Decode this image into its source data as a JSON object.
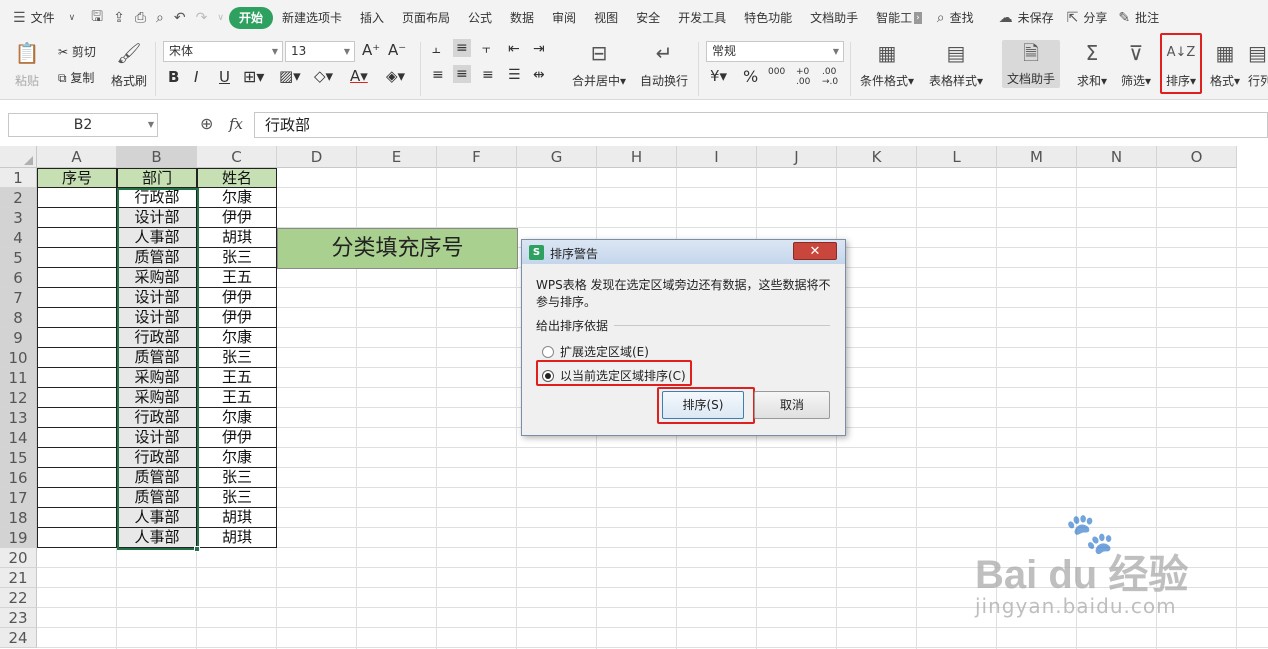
{
  "menubar": {
    "file": "文件",
    "tabs": [
      "开始",
      "新建选项卡",
      "插入",
      "页面布局",
      "公式",
      "数据",
      "审阅",
      "视图",
      "安全",
      "开发工具",
      "特色功能",
      "文档助手",
      "智能工"
    ],
    "active_tab": "开始",
    "search": "查找",
    "unsaved": "未保存",
    "share": "分享",
    "comment": "批注"
  },
  "ribbon": {
    "paste": "粘贴",
    "cut": "剪切",
    "copy": "复制",
    "format_painter": "格式刷",
    "font_name": "宋体",
    "font_size": "13",
    "number_format": "常规",
    "merge_center": "合并居中",
    "wrap_text": "自动换行",
    "cond_format": "条件格式",
    "table_style": "表格样式",
    "doc_helper": "文档助手",
    "sum": "求和",
    "filter": "筛选",
    "sort": "排序",
    "format": "格式",
    "row_col": "行列"
  },
  "formula_bar": {
    "name_box": "B2",
    "fx": "fx",
    "content": "行政部"
  },
  "columns": [
    "A",
    "B",
    "C",
    "D",
    "E",
    "F",
    "G",
    "H",
    "I",
    "J",
    "K",
    "L",
    "M",
    "N",
    "O"
  ],
  "rows": [
    "1",
    "2",
    "3",
    "4",
    "5",
    "6",
    "7",
    "8",
    "9",
    "10",
    "11",
    "12",
    "13",
    "14",
    "15",
    "16",
    "17",
    "18",
    "19",
    "20",
    "21",
    "22",
    "23",
    "24"
  ],
  "headers": {
    "a": "序号",
    "b": "部门",
    "c": "姓名"
  },
  "departments": [
    "行政部",
    "设计部",
    "人事部",
    "质管部",
    "采购部",
    "设计部",
    "设计部",
    "行政部",
    "质管部",
    "采购部",
    "采购部",
    "行政部",
    "设计部",
    "行政部",
    "质管部",
    "质管部",
    "人事部",
    "人事部"
  ],
  "names": [
    "尔康",
    "伊伊",
    "胡琪",
    "张三",
    "王五",
    "伊伊",
    "伊伊",
    "尔康",
    "张三",
    "王五",
    "王五",
    "尔康",
    "伊伊",
    "尔康",
    "张三",
    "张三",
    "胡琪",
    "胡琪"
  ],
  "banner": "分类填充序号",
  "dialog": {
    "title": "排序警告",
    "message": "WPS表格 发现在选定区域旁边还有数据，这些数据将不参与排序。",
    "group": "给出排序依据",
    "option1": "扩展选定区域(E)",
    "option2": "以当前选定区域排序(C)",
    "ok": "排序(S)",
    "cancel": "取消",
    "selected": "option2"
  },
  "watermark": {
    "brand": "Bai du 经验",
    "url": "jingyan.baidu.com"
  }
}
